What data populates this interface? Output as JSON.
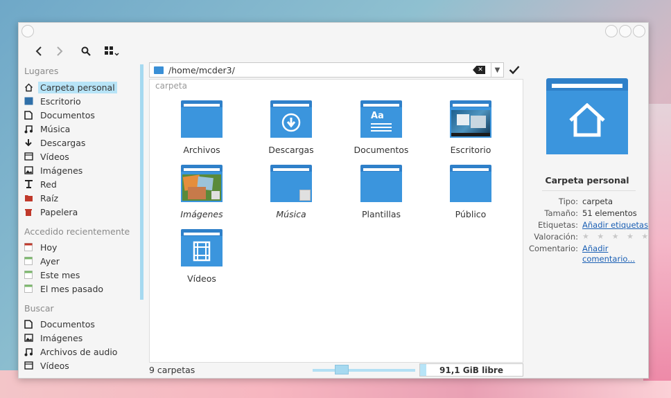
{
  "toolbar": {
    "back": "‹",
    "forward": "›",
    "search": "search-icon",
    "view": "view-mode-icon"
  },
  "sidebar": {
    "sections": [
      {
        "title": "Lugares",
        "items": [
          {
            "label": "Carpeta personal",
            "icon": "home-icon",
            "active": true
          },
          {
            "label": "Escritorio",
            "icon": "desktop-icon"
          },
          {
            "label": "Documentos",
            "icon": "document-icon"
          },
          {
            "label": "Música",
            "icon": "music-icon"
          },
          {
            "label": "Descargas",
            "icon": "download-icon"
          },
          {
            "label": "Vídeos",
            "icon": "video-icon"
          },
          {
            "label": "Imágenes",
            "icon": "image-icon"
          },
          {
            "label": "Red",
            "icon": "network-icon"
          },
          {
            "label": "Raíz",
            "icon": "root-folder-icon"
          },
          {
            "label": "Papelera",
            "icon": "trash-icon"
          }
        ]
      },
      {
        "title": "Accedido recientemente",
        "items": [
          {
            "label": "Hoy",
            "icon": "calendar-today-icon"
          },
          {
            "label": "Ayer",
            "icon": "calendar-yesterday-icon"
          },
          {
            "label": "Este mes",
            "icon": "calendar-month-icon"
          },
          {
            "label": "El mes pasado",
            "icon": "calendar-lastmonth-icon"
          }
        ]
      },
      {
        "title": "Buscar",
        "items": [
          {
            "label": "Documentos",
            "icon": "document-icon"
          },
          {
            "label": "Imágenes",
            "icon": "image-icon"
          },
          {
            "label": "Archivos de audio",
            "icon": "music-icon"
          },
          {
            "label": "Vídeos",
            "icon": "video-icon"
          }
        ]
      }
    ]
  },
  "location": {
    "path": "/home/mcder3/"
  },
  "main": {
    "group_label": "carpeta",
    "items": [
      {
        "label": "Archivos",
        "type": "folder"
      },
      {
        "label": "Descargas",
        "type": "folder-download"
      },
      {
        "label": "Documentos",
        "type": "folder-documents"
      },
      {
        "label": "Escritorio",
        "type": "folder-desktop"
      },
      {
        "label": "Imágenes",
        "type": "folder-images",
        "italic": true
      },
      {
        "label": "Música",
        "type": "folder-music",
        "italic": true
      },
      {
        "label": "Plantillas",
        "type": "folder"
      },
      {
        "label": "Público",
        "type": "folder"
      },
      {
        "label": "Vídeos",
        "type": "folder-videos"
      }
    ]
  },
  "status": {
    "count": "9 carpetas",
    "free": "91,1 GiB libre",
    "used_fraction": 0.06
  },
  "info": {
    "title": "Carpeta personal",
    "rows": [
      {
        "key": "Tipo:",
        "value": "carpeta"
      },
      {
        "key": "Tamaño:",
        "value": "51 elementos"
      },
      {
        "key": "Etiquetas:",
        "value": "Añadir etiquetas",
        "link": true
      },
      {
        "key": "Valoración:",
        "value": "★ ★ ★ ★ ★",
        "stars": true
      },
      {
        "key": "Comentario:",
        "value": "Añadir comentario...",
        "link": true
      }
    ]
  },
  "colors": {
    "folder": "#3b95dd",
    "folder_tab": "#2f80c9",
    "selection": "#b7e4f7",
    "link": "#1a5fb4"
  }
}
